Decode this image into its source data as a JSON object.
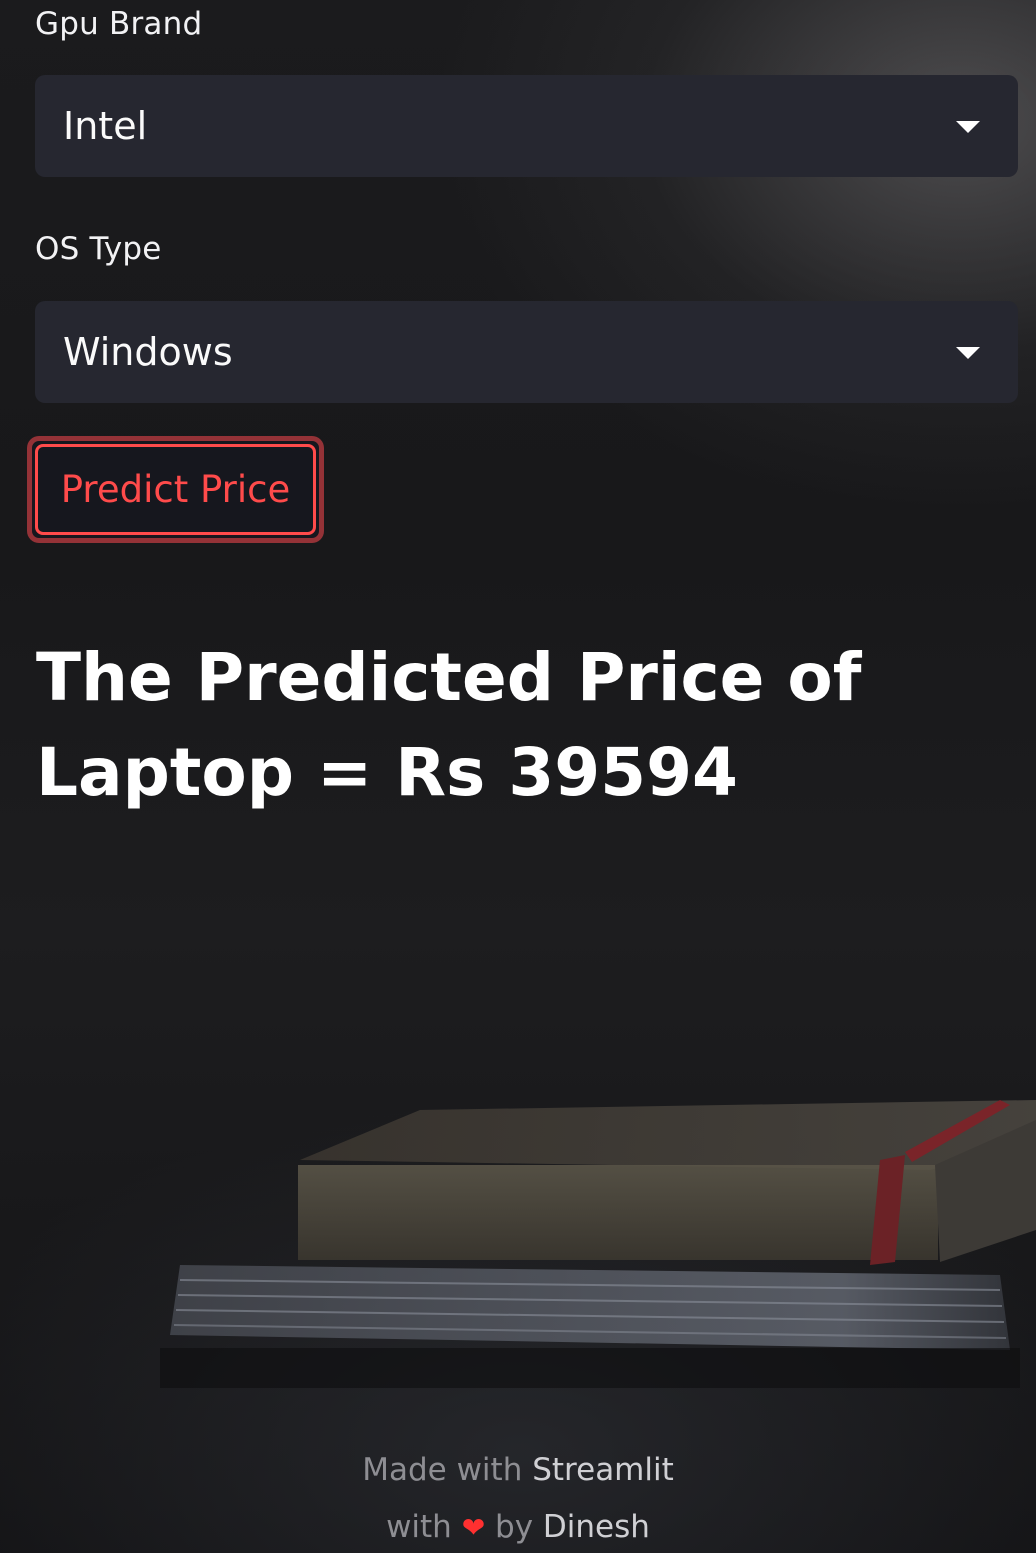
{
  "form": {
    "gpu_brand": {
      "label": "Gpu Brand",
      "value": "Intel"
    },
    "os_type": {
      "label": "OS Type",
      "value": "Windows"
    },
    "predict_button_label": "Predict Price"
  },
  "result": {
    "line1": "The Predicted Price of",
    "line2": "Laptop = Rs 39594"
  },
  "footer": {
    "made_with": "Made with",
    "streamlit": "Streamlit",
    "with": "with",
    "heart_icon": "heart-icon",
    "by": "by",
    "author": "Dinesh"
  },
  "colors": {
    "accent": "#ff4b4b",
    "select_bg": "#262730",
    "heart": "#ff3030"
  }
}
